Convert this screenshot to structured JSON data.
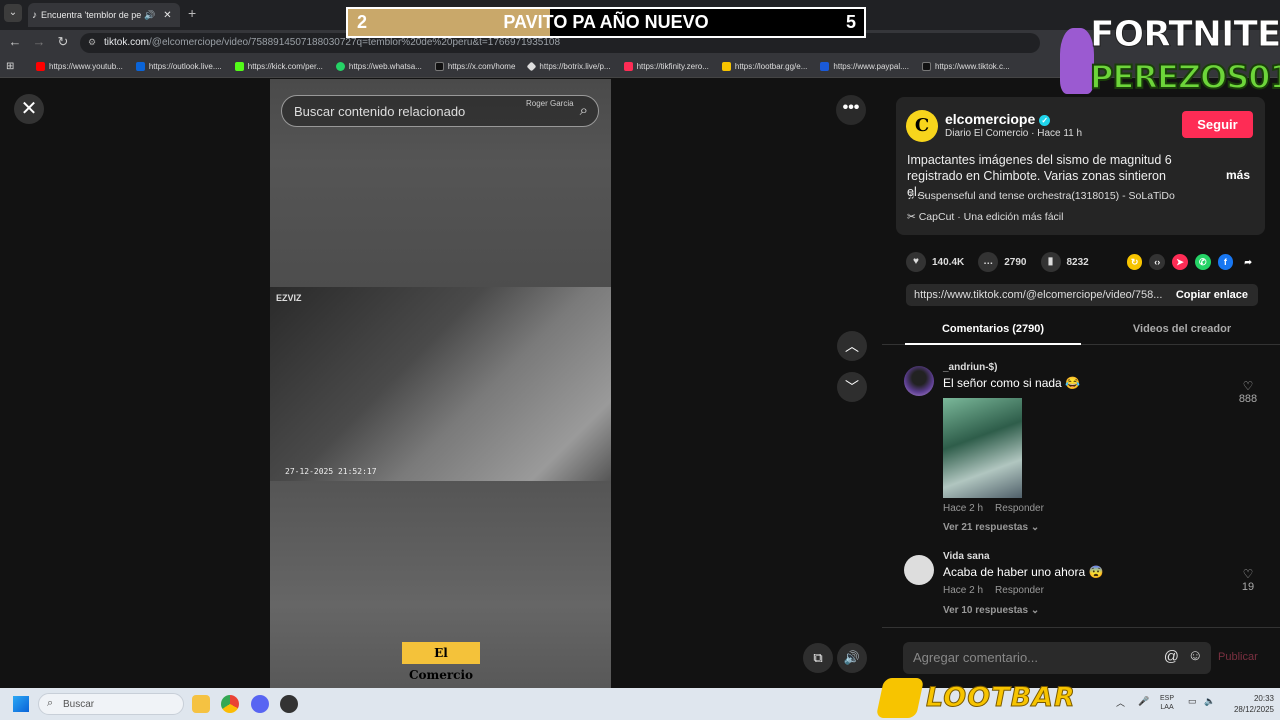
{
  "browser": {
    "tab_title": "Encuentra 'temblor de peru",
    "url_host": "tiktok.com",
    "url_path": "/@elcomerciope/video/7588914507188030727q=temblor%20de%20peru&t=1766971935108",
    "bookmarks": [
      {
        "label": "https://www.youtub...",
        "color": "#ff0000"
      },
      {
        "label": "https://outlook.live....",
        "color": "#0a64d8"
      },
      {
        "label": "https://kick.com/per...",
        "color": "#53fc18"
      },
      {
        "label": "https://web.whatsa...",
        "color": "#25d366"
      },
      {
        "label": "https://x.com/home",
        "color": "#000000"
      },
      {
        "label": "https://botrix.live/p...",
        "color": "#dddddd"
      },
      {
        "label": "https://tikfinity.zero...",
        "color": "#fe2c55"
      },
      {
        "label": "https://lootbar.gg/e...",
        "color": "#f7c400"
      },
      {
        "label": "https://www.paypal....",
        "color": "#003087"
      },
      {
        "label": "https://www.tiktok.c...",
        "color": "#000000"
      }
    ]
  },
  "banner": {
    "left_num": "2",
    "label": "PAVITO PA AÑO NUEVO",
    "right_num": "5"
  },
  "fortnite": {
    "line1": "FORTNITE",
    "line2": "PEREZOS01"
  },
  "video": {
    "search_placeholder": "Buscar contenido relacionado",
    "credit": "Roger Garcia",
    "cam_brand": "EZVIZ",
    "cam_timestamp": "27-12-2025 21:52:17",
    "watermark": "El Comercio"
  },
  "post": {
    "username": "elcomerciope",
    "subtitle": "Diario El Comercio · Hace 11 h",
    "follow_label": "Seguir",
    "description": "Impactantes imágenes del sismo de magnitud 6 registrado en Chimbote. Varias zonas sintieron el...",
    "more_label": "más",
    "music": "Suspenseful and tense orchestra(1318015) - SoLaTiDo",
    "capcut": "CapCut · Una edición más fácil",
    "likes": "140.4K",
    "comments": "2790",
    "saves": "8232",
    "link": "https://www.tiktok.com/@elcomerciope/video/758...",
    "copy_label": "Copiar enlace",
    "tab_comments": "Comentarios (2790)",
    "tab_videos": "Videos del creador"
  },
  "comments": [
    {
      "user": "_andriun-$)",
      "text": "El señor como si nada 😂",
      "time": "Hace 2 h",
      "reply": "Responder",
      "replies": "Ver 21 respuestas",
      "likes": "888"
    },
    {
      "user": "Vida sana",
      "text": "Acaba de haber uno ahora 😨",
      "time": "Hace 2 h",
      "reply": "Responder",
      "replies": "Ver 10 respuestas",
      "likes": "19"
    }
  ],
  "comment_box": {
    "placeholder": "Agregar comentario...",
    "publish": "Publicar"
  },
  "taskbar": {
    "search": "Buscar",
    "lootbar": "LOOTBAR",
    "lang_top": "ESP",
    "lang_bottom": "LAA",
    "time": "20:33",
    "date": "28/12/2025"
  }
}
